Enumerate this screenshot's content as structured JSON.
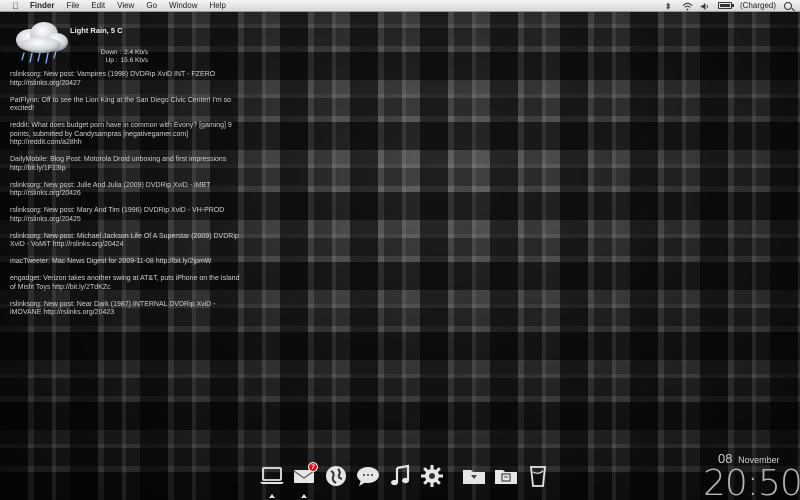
{
  "menubar": {
    "app_name": "Finder",
    "items": [
      "File",
      "Edit",
      "View",
      "Go",
      "Window",
      "Help"
    ],
    "battery_status": "(Charged)",
    "battery_level": 1.0
  },
  "weather": {
    "condition": "Light Rain, 5 C",
    "icon": "rain-cloud-icon",
    "down_label": "Down :",
    "down_value": "2.4 Kb/s",
    "up_label": "Up :",
    "up_value": "15.6 Kb/s"
  },
  "feed": [
    "rslinksorg: New post: Vampires (1998) DVDRip XviD INT - FZERO http://rslinks.org/20427",
    "PatFlynn: Off to see the Lion King at the San Diego Civic Center! I'm so excited!",
    "reddit: What does budget porn have in common with Evony? [gaming] 9 points, submitted by Candysampras [negativegamer.com] http://reddit.com/a28hh",
    "DailyMobile: Blog Post: Motorola Droid unboxing and first impressions http://bit.ly/1F13Ip",
    "rslinksorg: New post: Julie And Julia (2009) DVDRip XviD - iMBT http://rslinks.org/20426",
    "rslinksorg: New post: Mary And Tim (1996) DVDRip XviD - VH-PROD http://rslinks.org/20425",
    "rslinksorg: New post: Michael Jackson Life Of A Superstar (2009) DVDRip XviD - VoMiT http://rslinks.org/20424",
    "macTweeter: Mac News Digest for 2009-11-08 http://bit.ly/2jpmW",
    "engadget: Verizon takes another swing at AT&T, puts iPhone on the Island of Misfit Toys http://bit.ly/2TdKZc",
    "rslinksorg: New post: Near Dark (1987) INTERNAL DVDRip XviD - iMOVANE http://rslinks.org/20423"
  ],
  "dock": {
    "mail_badge": "7",
    "items": [
      {
        "name": "finder-laptop-icon",
        "running": true
      },
      {
        "name": "mail-icon",
        "running": true
      },
      {
        "name": "globe-icon",
        "running": false
      },
      {
        "name": "chat-bubble-icon",
        "running": false
      },
      {
        "name": "music-note-icon",
        "running": false
      },
      {
        "name": "gear-icon",
        "running": false
      },
      {
        "name": "downloads-folder-icon",
        "running": false
      },
      {
        "name": "documents-folder-icon",
        "running": false
      },
      {
        "name": "trash-icon",
        "running": false
      }
    ]
  },
  "clock": {
    "day": "08",
    "month": "November",
    "time": "20:50"
  }
}
